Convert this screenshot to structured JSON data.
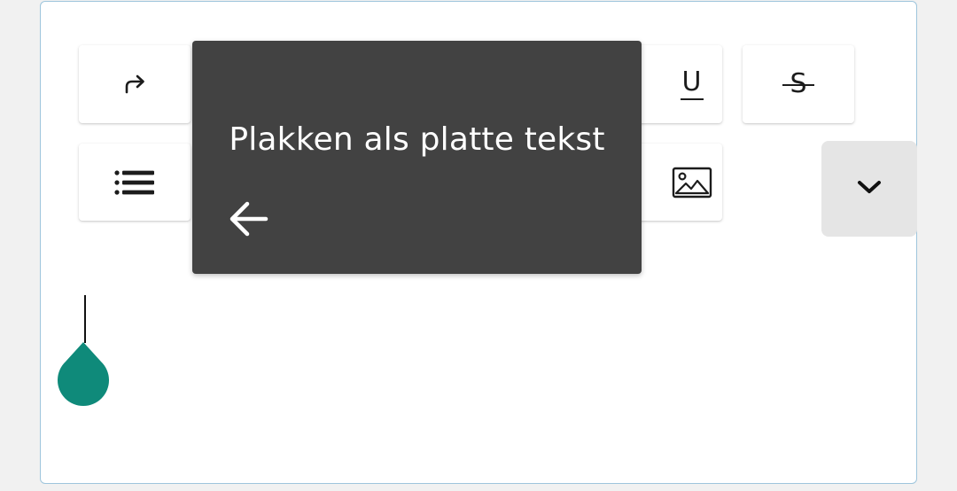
{
  "toolbar": {
    "buttons": [
      {
        "name": "redo",
        "icon": "redo-icon"
      },
      {
        "name": "underline",
        "icon": "underline-icon",
        "glyph": "U"
      },
      {
        "name": "strikethrough",
        "icon": "strikethrough-icon",
        "glyph": "S"
      },
      {
        "name": "bulleted-list",
        "icon": "bulleted-list-icon"
      },
      {
        "name": "insert-image",
        "icon": "image-icon"
      },
      {
        "name": "more",
        "icon": "chevron-down-icon"
      }
    ]
  },
  "tooltip": {
    "text": "Plakken als platte tekst",
    "back_icon": "arrow-left-icon"
  },
  "colors": {
    "editor_border": "#9ec5dc",
    "tooltip_bg": "#424242",
    "cursor_handle": "#0f8a7a",
    "more_button_bg": "#e5e5e5"
  }
}
